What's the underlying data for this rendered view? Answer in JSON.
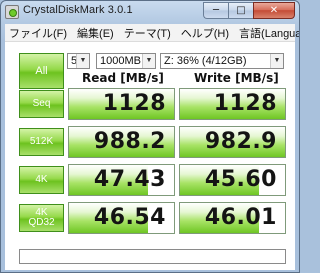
{
  "window": {
    "title": "CrystalDiskMark 3.0.1",
    "minimize_glyph": "─",
    "maximize_glyph": "□",
    "close_glyph": "✕"
  },
  "menu": [
    "ファイル(F)",
    "編集(E)",
    "テーマ(T)",
    "ヘルプ(H)",
    "言語(Language)"
  ],
  "controls": {
    "all_label": "All",
    "test_count": "5",
    "test_size": "1000MB",
    "drive": "Z: 36% (4/12GB)",
    "dropdown_glyph": "▼"
  },
  "headers": {
    "read": "Read [MB/s]",
    "write": "Write [MB/s]"
  },
  "rows": [
    {
      "label": "Seq",
      "read": "1128",
      "write": "1128",
      "read_fill": 1.0,
      "write_fill": 1.0
    },
    {
      "label": "512K",
      "read": "988.2",
      "write": "982.9",
      "read_fill": 1.0,
      "write_fill": 1.0
    },
    {
      "label": "4K",
      "read": "47.43",
      "write": "45.60",
      "read_fill": 0.75,
      "write_fill": 0.75
    },
    {
      "label_line1": "4K",
      "label_line2": "QD32",
      "read": "46.54",
      "write": "46.01",
      "read_fill": 0.75,
      "write_fill": 0.75
    }
  ],
  "comment": {
    "value": ""
  },
  "colors": {
    "accent_green": "#6dc21f",
    "title_bar": "#b3c9e2",
    "close_red": "#c44b35"
  }
}
